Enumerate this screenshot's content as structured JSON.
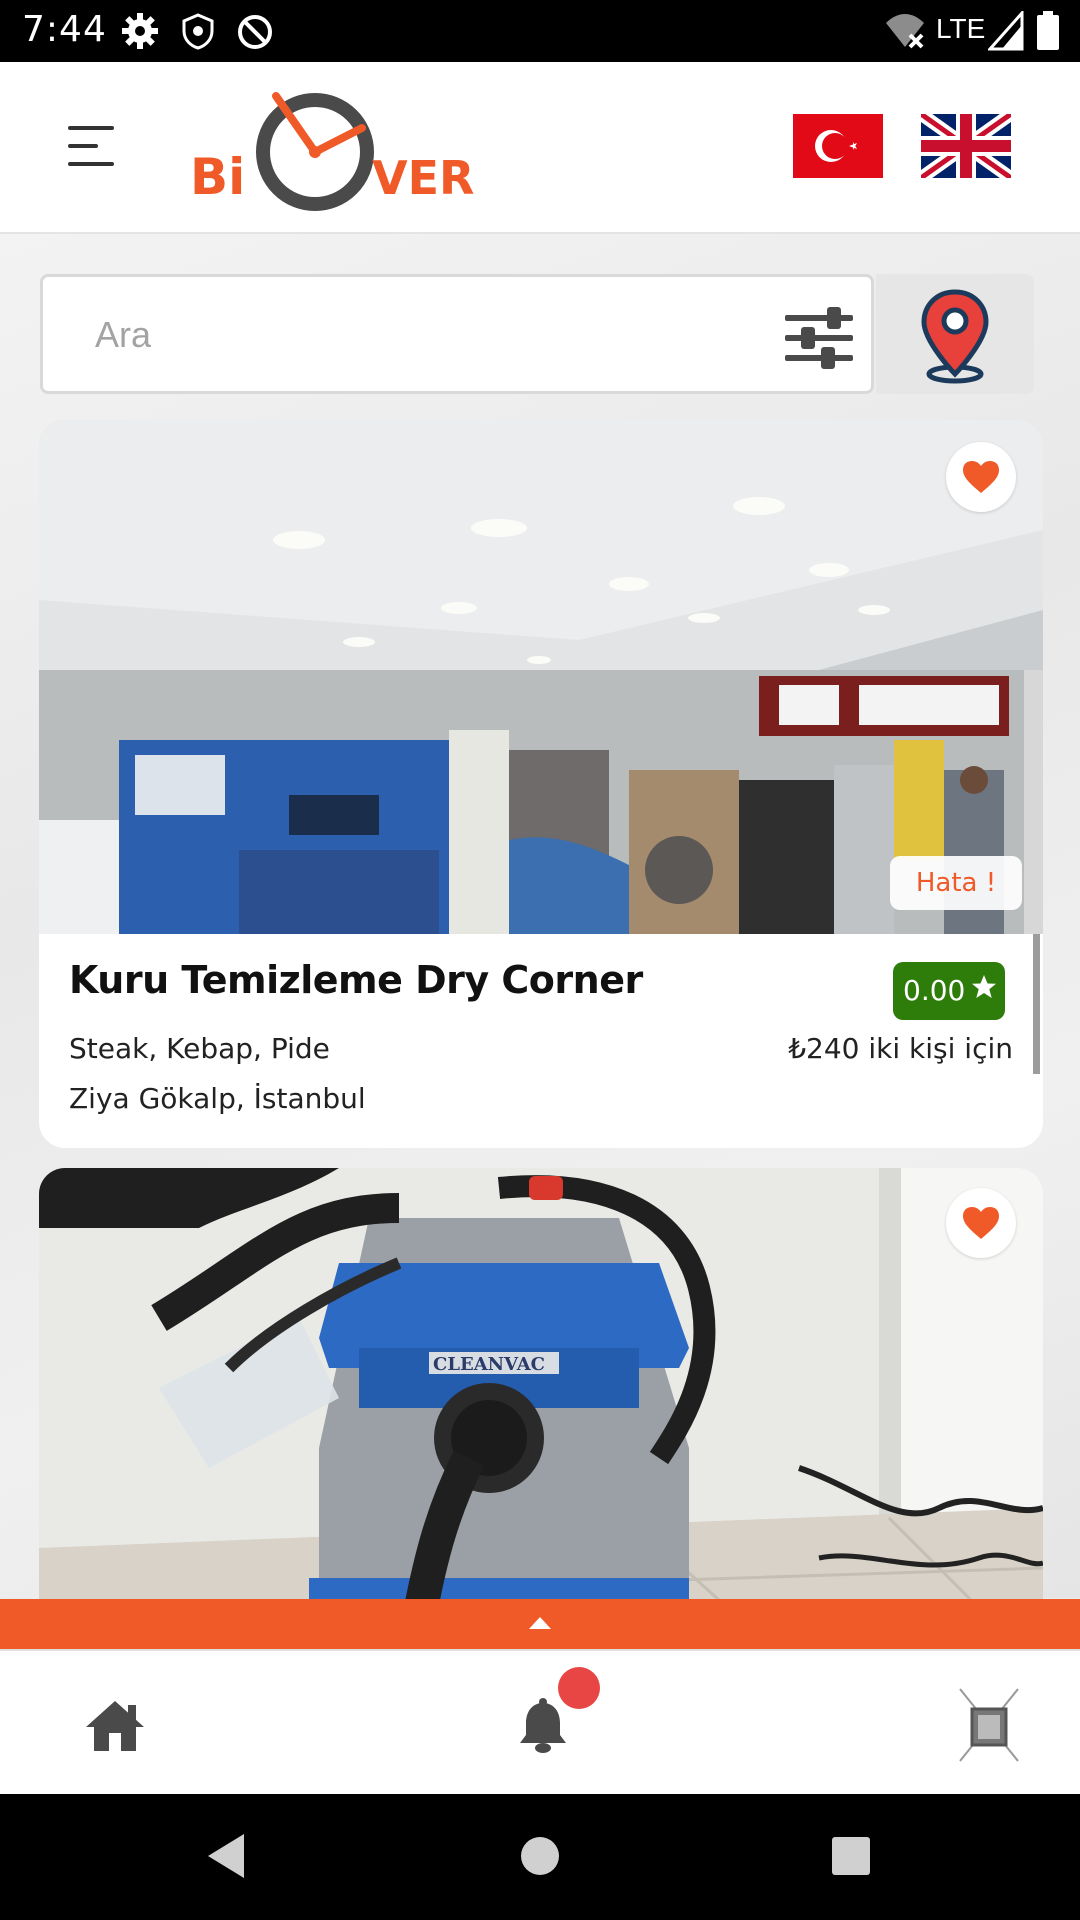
{
  "status_bar": {
    "time": "7:44",
    "network": "LTE",
    "icons": [
      "settings-icon",
      "vpn-shield-icon",
      "sync-icon",
      "wifi-off-icon",
      "signal-icon",
      "battery-icon"
    ]
  },
  "header": {
    "logo_text_left": "Bi",
    "logo_text_right": "VER",
    "languages": [
      "Türkçe",
      "English"
    ],
    "icons": [
      "menu-icon",
      "turkey-flag-icon",
      "uk-flag-icon"
    ]
  },
  "search": {
    "placeholder": "Ara",
    "value": "",
    "icons": [
      "filter-sliders-icon",
      "map-pin-icon"
    ]
  },
  "cards": [
    {
      "title": "Kuru Temizleme Dry Corner",
      "rating": "0.00",
      "cuisine": "Steak, Kebap, Pide",
      "price": "₺240 iki kişi için",
      "location": "Ziya Gökalp, İstanbul",
      "badge": "Hata !",
      "favorite": true
    },
    {
      "favorite": true,
      "image_text": "CLEANVAC"
    }
  ],
  "bottom_nav": {
    "items": [
      "home-icon",
      "bell-icon",
      "reservation-icon"
    ],
    "notification_dot": true
  },
  "colors": {
    "brand_orange": "#f05a28",
    "rating_green": "#2e7d0a",
    "notification_red": "#e84545",
    "dark_gray": "#4a4a4a"
  }
}
